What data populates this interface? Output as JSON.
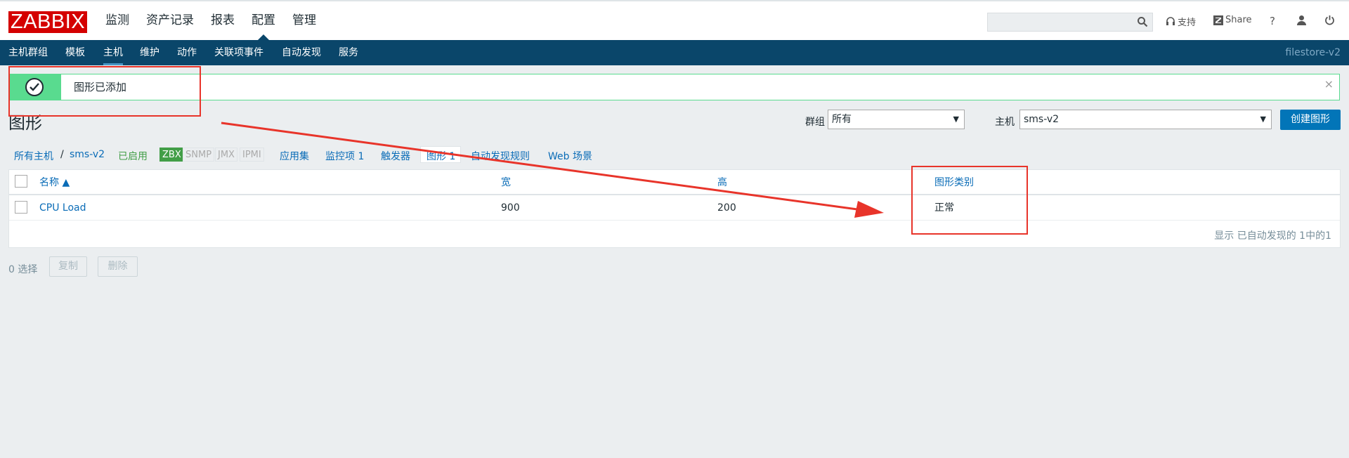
{
  "header": {
    "logo": "ZABBIX",
    "menu": [
      {
        "label": "监测",
        "selected": false
      },
      {
        "label": "资产记录",
        "selected": false
      },
      {
        "label": "报表",
        "selected": false
      },
      {
        "label": "配置",
        "selected": true
      },
      {
        "label": "管理",
        "selected": false
      }
    ],
    "search_value": "",
    "support_label": "支持",
    "share_label": "Share",
    "help_label": "?"
  },
  "subnav": {
    "items": [
      "主机群组",
      "模板",
      "主机",
      "维护",
      "动作",
      "关联项事件",
      "自动发现",
      "服务"
    ],
    "selected": "主机",
    "server_name": "filestore-v2"
  },
  "message": {
    "text": "图形已添加",
    "close": "×",
    "status_color": "#59db8f"
  },
  "page": {
    "title": "图形",
    "group_label": "群组",
    "group_value": "所有",
    "host_label": "主机",
    "host_value": "sms-v2",
    "create_button": "创建图形"
  },
  "host_nav": {
    "all_hosts": "所有主机",
    "separator": "/",
    "host": "sms-v2",
    "status": "已启用",
    "badges": [
      {
        "label": "ZBX",
        "active": true
      },
      {
        "label": "SNMP",
        "active": false
      },
      {
        "label": "JMX",
        "active": false
      },
      {
        "label": "IPMI",
        "active": false
      }
    ],
    "tabs": [
      "应用集",
      "监控项 1",
      "触发器",
      "图形 1",
      "自动发现规则",
      "Web 场景"
    ],
    "current_tab": "图形 1"
  },
  "table": {
    "columns": [
      "名称 ▲",
      "宽",
      "高",
      "图形类别"
    ],
    "rows": [
      {
        "name": "CPU Load",
        "width": "900",
        "height": "200",
        "type": "正常"
      }
    ],
    "pager": "显示 已自动发现的 1中的1"
  },
  "footer": {
    "selected_count": "0 选择",
    "copy_button": "复制",
    "delete_button": "删除"
  },
  "colors": {
    "brand_red": "#d40000",
    "nav_dark": "#0a466a",
    "accent_blue": "#0275b8",
    "annotation_red": "#e8342a"
  }
}
